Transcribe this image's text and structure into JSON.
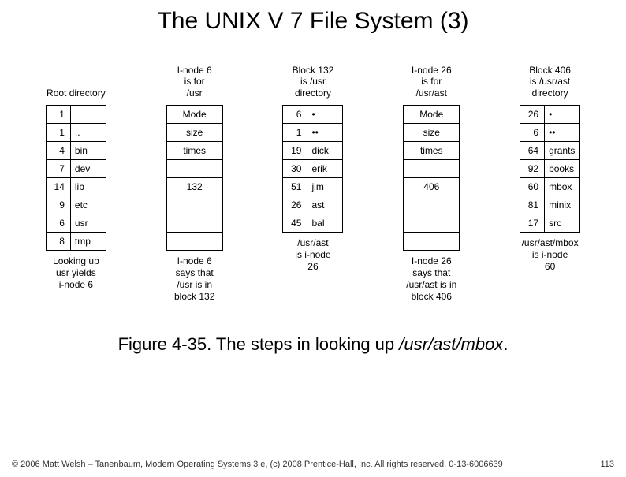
{
  "title": "The UNIX V 7 File System (3)",
  "columns": [
    {
      "header": [
        "Root directory"
      ],
      "type": "dir",
      "rows": [
        [
          "1",
          "."
        ],
        [
          "1",
          ".."
        ],
        [
          "4",
          "bin"
        ],
        [
          "7",
          "dev"
        ],
        [
          "14",
          "lib"
        ],
        [
          "9",
          "etc"
        ],
        [
          "6",
          "usr"
        ],
        [
          "8",
          "tmp"
        ]
      ],
      "footer": [
        "Looking up",
        "usr yields",
        "i-node 6"
      ]
    },
    {
      "header": [
        "I-node 6",
        "is for",
        "/usr"
      ],
      "type": "inode",
      "attrs": [
        "Mode",
        "size",
        "times"
      ],
      "ptr": "132",
      "footer": [
        "I-node 6",
        "says that",
        "/usr is in",
        "block 132"
      ]
    },
    {
      "header": [
        "Block 132",
        "is /usr",
        "directory"
      ],
      "type": "dir",
      "rows": [
        [
          "6",
          "•"
        ],
        [
          "1",
          "••"
        ],
        [
          "19",
          "dick"
        ],
        [
          "30",
          "erik"
        ],
        [
          "51",
          "jim"
        ],
        [
          "26",
          "ast"
        ],
        [
          "45",
          "bal"
        ]
      ],
      "footer": [
        "/usr/ast",
        "is i-node",
        "26"
      ]
    },
    {
      "header": [
        "I-node 26",
        "is for",
        "/usr/ast"
      ],
      "type": "inode",
      "attrs": [
        "Mode",
        "size",
        "times"
      ],
      "ptr": "406",
      "footer": [
        "I-node 26",
        "says that",
        "/usr/ast is in",
        "block 406"
      ]
    },
    {
      "header": [
        "Block 406",
        "is /usr/ast",
        "directory"
      ],
      "type": "dir",
      "rows": [
        [
          "26",
          "•"
        ],
        [
          "6",
          "••"
        ],
        [
          "64",
          "grants"
        ],
        [
          "92",
          "books"
        ],
        [
          "60",
          "mbox"
        ],
        [
          "81",
          "minix"
        ],
        [
          "17",
          "src"
        ]
      ],
      "footer": [
        "/usr/ast/mbox",
        "is i-node",
        "60"
      ]
    }
  ],
  "caption_prefix": "Figure 4-35. The steps in looking up ",
  "caption_path": "/usr/ast/mbox",
  "caption_suffix": ".",
  "copyright": "© 2006 Matt Welsh – Tanenbaum, Modern Operating Systems 3 e, (c) 2008 Prentice-Hall, Inc. All rights reserved. 0-13-6006639",
  "page_num": "113"
}
